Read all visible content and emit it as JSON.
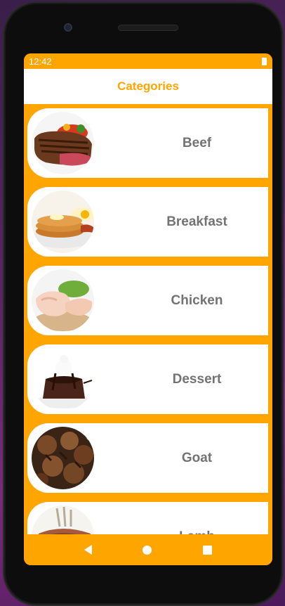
{
  "status": {
    "time": "12:42"
  },
  "appbar": {
    "title": "Categories"
  },
  "categories": [
    {
      "label": "Beef",
      "icon": "beef-image"
    },
    {
      "label": "Breakfast",
      "icon": "breakfast-image"
    },
    {
      "label": "Chicken",
      "icon": "chicken-image"
    },
    {
      "label": "Dessert",
      "icon": "dessert-image"
    },
    {
      "label": "Goat",
      "icon": "goat-image"
    },
    {
      "label": "Lamb",
      "icon": "lamb-image"
    }
  ],
  "colors": {
    "accent": "#ffa500",
    "label": "#737373",
    "card": "#ffffff"
  }
}
